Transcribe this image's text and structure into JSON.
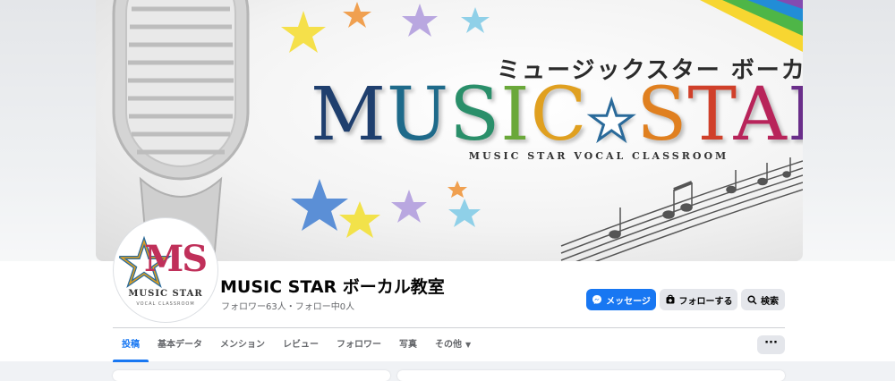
{
  "cover": {
    "subtitle": "ミュージックスター ボーカル教室",
    "title_letters": [
      {
        "char": "M",
        "color": "#1f3f6e"
      },
      {
        "char": "U",
        "color": "#1e6a8a"
      },
      {
        "char": "S",
        "color": "#2a8f6a"
      },
      {
        "char": "I",
        "color": "#6aa83a"
      },
      {
        "char": "C",
        "color": "#e0a020"
      },
      {
        "char": "★",
        "color": "#ffffff"
      },
      {
        "char": "S",
        "color": "#e08020"
      },
      {
        "char": "T",
        "color": "#d0402a"
      },
      {
        "char": "A",
        "color": "#b8245a"
      },
      {
        "char": "R",
        "color": "#6a2e8a"
      }
    ],
    "tagline": "MUSIC STAR VOCAL CLASSROOM"
  },
  "profile": {
    "avatar_logo": "MS",
    "avatar_name": "MUSIC STAR",
    "avatar_sub": "VOCAL CLASSROOM",
    "name": "MUSIC STAR ボーカル教室",
    "stats": "フォロワー63人・フォロー中0人"
  },
  "actions": {
    "message": {
      "label": "メッセージ",
      "icon": "messenger-icon"
    },
    "follow": {
      "label": "フォローする",
      "icon": "follow-icon"
    },
    "search": {
      "label": "検索",
      "icon": "search-icon"
    }
  },
  "tabs": [
    {
      "label": "投稿",
      "active": true
    },
    {
      "label": "基本データ",
      "active": false
    },
    {
      "label": "メンション",
      "active": false
    },
    {
      "label": "レビュー",
      "active": false
    },
    {
      "label": "フォロワー",
      "active": false
    },
    {
      "label": "写真",
      "active": false
    },
    {
      "label": "その他",
      "active": false,
      "dropdown": true
    }
  ],
  "more_button": "···",
  "colors": {
    "accent": "#1877f2",
    "button_gray": "#e4e6eb",
    "secondary_text": "#65676b"
  }
}
